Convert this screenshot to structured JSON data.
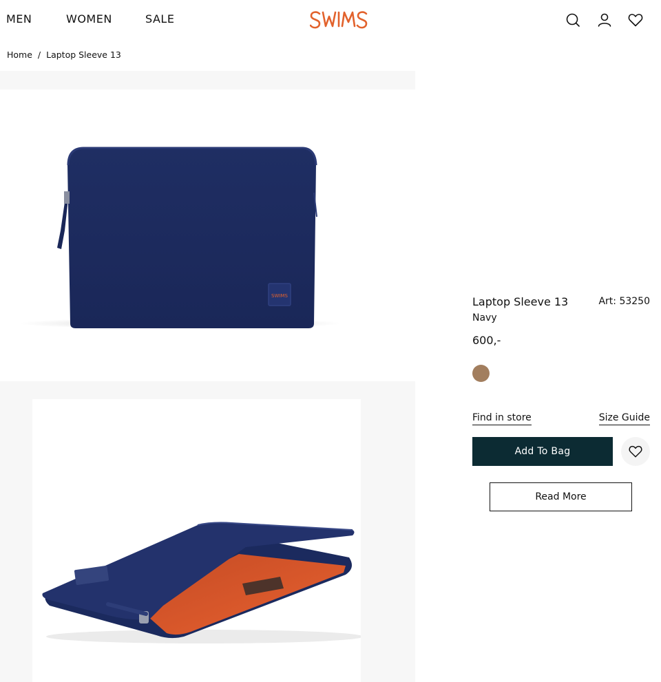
{
  "header": {
    "nav": [
      {
        "label": "MEN"
      },
      {
        "label": "WOMEN"
      },
      {
        "label": "SALE"
      }
    ],
    "logo_text": "SWIMS",
    "brand_color": "#e2622c",
    "icons": [
      "search-icon",
      "account-icon",
      "wishlist-icon"
    ]
  },
  "breadcrumb": {
    "home": "Home",
    "separator": "/",
    "current": "Laptop Sleeve 13"
  },
  "gallery": {
    "images": [
      {
        "name": "product-image-front",
        "logo_text": "SWIMS"
      },
      {
        "name": "product-image-open"
      }
    ]
  },
  "product": {
    "name": "Laptop Sleeve 13",
    "article": "Art: 53250",
    "color": "Navy",
    "price": "600,-",
    "swatch_color": "#a27e5e",
    "find_in_store": "Find in store",
    "size_guide": "Size Guide",
    "add_to_bag": "Add To Bag",
    "read_more": "Read More",
    "button_color": "#0c2b33"
  }
}
